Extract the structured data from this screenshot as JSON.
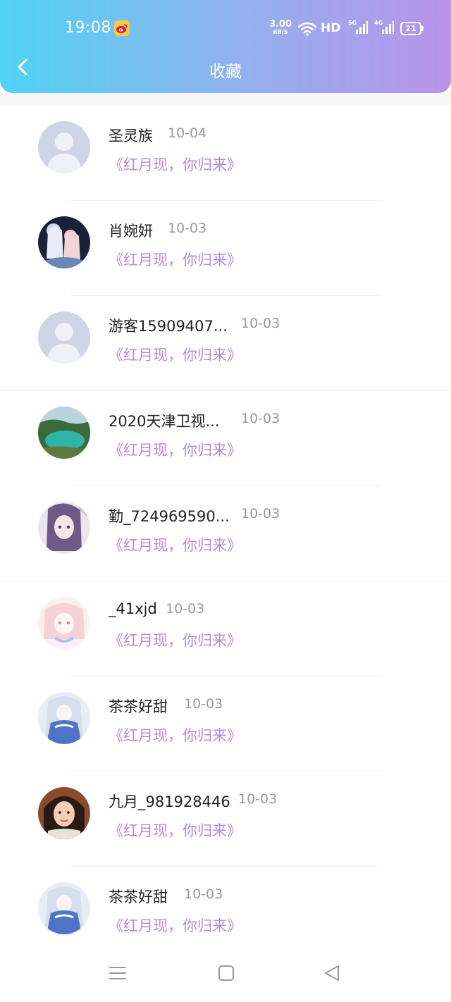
{
  "status_bar": {
    "time": "19:08",
    "net_speed": "3.00",
    "net_unit": "KB/S",
    "hd": "HD",
    "sig_5g": "5G",
    "sig_4g": "4G",
    "battery": "21"
  },
  "header": {
    "title": "收藏",
    "back_icon": "chevron-left-icon"
  },
  "items": [
    {
      "name": "圣灵族",
      "date": "10-04",
      "title": "《红月现，你归来》",
      "avatar": "default"
    },
    {
      "name": "肖婉妍",
      "date": "10-03",
      "title": "《红月现，你归来》",
      "avatar": "anime-couple"
    },
    {
      "name": "游客15909407...",
      "date": "10-03",
      "title": "《红月现，你归来》",
      "avatar": "default"
    },
    {
      "name": "2020天津卫视...",
      "date": "10-03",
      "title": "《红月现，你归来》",
      "avatar": "landscape"
    },
    {
      "name": "勤_724969590...",
      "date": "10-03",
      "title": "《红月现，你归来》",
      "avatar": "anime-girl"
    },
    {
      "name": "_41xjd",
      "date": "10-03",
      "title": "《红月现，你归来》",
      "avatar": "pink-girl"
    },
    {
      "name": "茶茶好甜",
      "date": "10-03",
      "title": "《红月现，你归来》",
      "avatar": "anime-blue"
    },
    {
      "name": "九月_981928446",
      "date": "10-03",
      "title": "《红月现，你归来》",
      "avatar": "photo-girl"
    },
    {
      "name": "茶茶好甜",
      "date": "10-03",
      "title": "《红月现，你归来》",
      "avatar": "anime-blue"
    }
  ],
  "nav": {
    "menu_icon": "menu-icon",
    "home_icon": "home-square-icon",
    "back_icon": "back-triangle-icon"
  },
  "colors": {
    "header_gradient_start": "#4fd3f5",
    "header_gradient_end": "#b993e8",
    "title_link": "#b48bdc",
    "date": "#9a9a9a"
  }
}
